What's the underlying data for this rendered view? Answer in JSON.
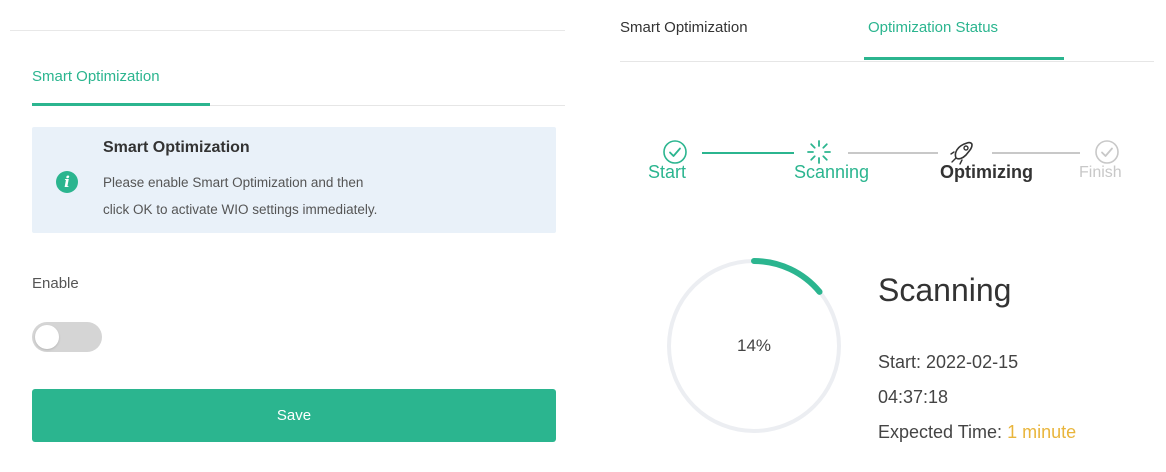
{
  "left": {
    "tab": "Smart Optimization",
    "info": {
      "icon": "info-icon",
      "title": "Smart Optimization",
      "line1": "Please enable Smart Optimization and then",
      "line2": "click OK to activate WIO settings immediately."
    },
    "enable_label": "Enable",
    "toggle_on": false,
    "save_label": "Save"
  },
  "right": {
    "tabs": [
      {
        "label": "Smart Optimization",
        "active": false
      },
      {
        "label": "Optimization Status",
        "active": true
      }
    ],
    "steps": [
      {
        "label": "Start",
        "icon": "check-circle-icon",
        "state": "done"
      },
      {
        "label": "Scanning",
        "icon": "loading-spinner-icon",
        "state": "active"
      },
      {
        "label": "Optimizing",
        "icon": "rocket-icon",
        "state": "current"
      },
      {
        "label": "Finish",
        "icon": "check-circle-icon",
        "state": "pending"
      }
    ],
    "progress": {
      "percent_label": "14%",
      "fraction": 0.14
    },
    "status_title": "Scanning",
    "start_line1": "Start: 2022-02-15",
    "start_line2": "04:37:18",
    "expected_label": "Expected Time: ",
    "expected_value": "1 minute"
  },
  "colors": {
    "accent": "#2bb58f",
    "info_bg": "#e9f1f9",
    "highlight": "#e9b53b",
    "pending": "#c8c8c8"
  }
}
